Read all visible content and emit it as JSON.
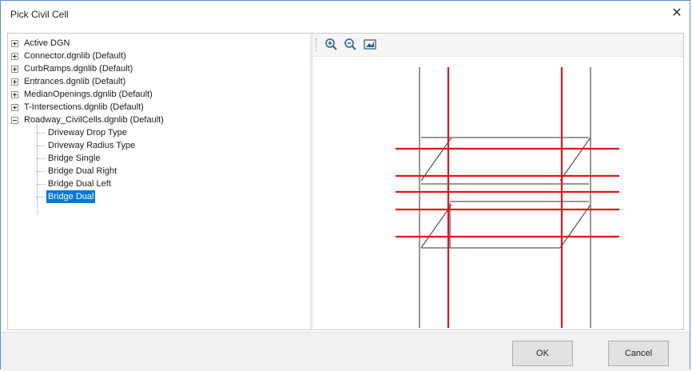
{
  "dialog": {
    "title": "Pick Civil Cell",
    "close_glyph": "✕"
  },
  "tree": {
    "roots": [
      {
        "label": "Active DGN",
        "expanded": false
      },
      {
        "label": "Connector.dgnlib (Default)",
        "expanded": false
      },
      {
        "label": "CurbRamps.dgnlib (Default)",
        "expanded": false
      },
      {
        "label": "Entrances.dgnlib (Default)",
        "expanded": false
      },
      {
        "label": "MedianOpenings.dgnlib (Default)",
        "expanded": false
      },
      {
        "label": "T-Intersections.dgnlib (Default)",
        "expanded": false
      },
      {
        "label": "Roadway_CivilCells.dgnlib (Default)",
        "expanded": true
      }
    ],
    "children": [
      {
        "label": "Driveway Drop Type",
        "selected": false
      },
      {
        "label": "Driveway Radius Type",
        "selected": false
      },
      {
        "label": "Bridge Single",
        "selected": false
      },
      {
        "label": "Bridge Dual Right",
        "selected": false
      },
      {
        "label": "Bridge Dual Left",
        "selected": false
      },
      {
        "label": "Bridge Dual",
        "selected": true
      }
    ]
  },
  "preview": {
    "toolbar": [
      {
        "name": "zoom-in-icon"
      },
      {
        "name": "zoom-out-icon"
      },
      {
        "name": "fit-view-icon"
      }
    ],
    "colors": {
      "red": "#e0151b",
      "gray": "#555555"
    }
  },
  "buttons": {
    "ok_label": "OK",
    "cancel_label": "Cancel"
  }
}
